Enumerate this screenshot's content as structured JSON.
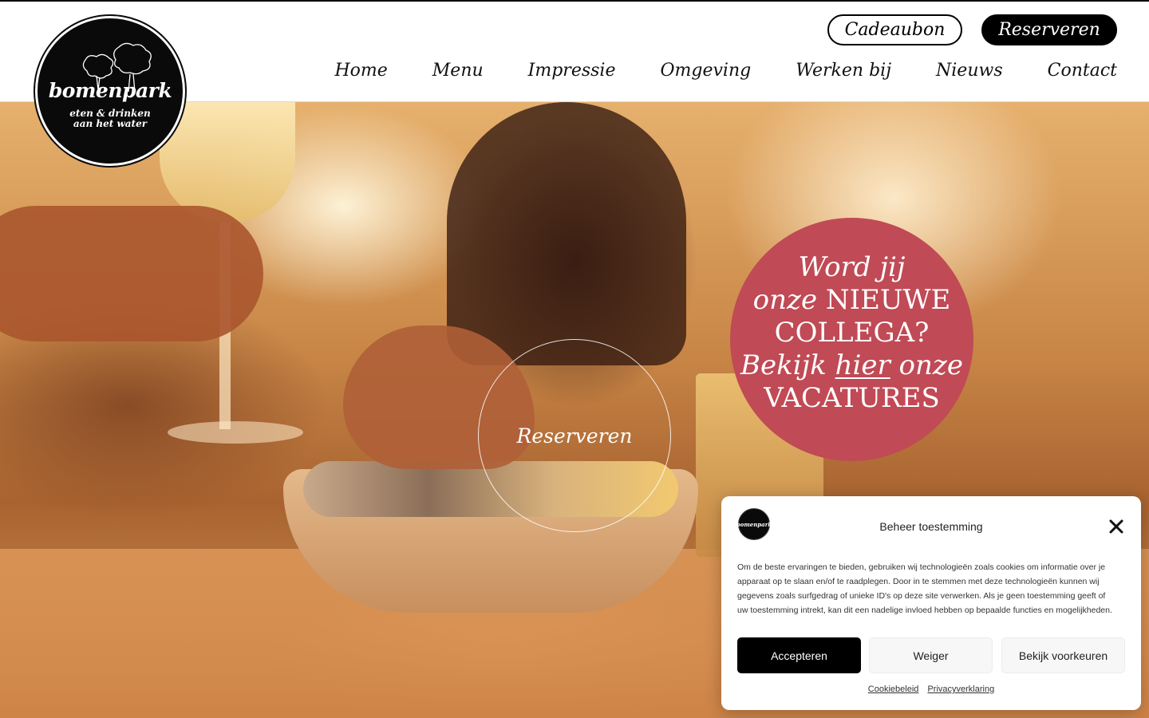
{
  "brand": {
    "name": "bomenpark",
    "tagline_1": "eten & drinken",
    "tagline_2": "aan het water"
  },
  "header": {
    "gift_label": "Cadeaubon",
    "reserve_label": "Reserveren",
    "nav": [
      "Home",
      "Menu",
      "Impressie",
      "Omgeving",
      "Werken bij",
      "Nieuws",
      "Contact"
    ]
  },
  "hero": {
    "reserve_label": "Reserveren",
    "vacancy": {
      "line1": "Word jij",
      "line2_italic": "onze",
      "line2_caps": "NIEUWE",
      "line3": "COLLEGA?",
      "line4_a": "Bekijk",
      "line4_link": "hier",
      "line4_b": "onze",
      "line5": "VACATURES"
    }
  },
  "cookie": {
    "title": "Beheer toestemming",
    "text": "Om de beste ervaringen te bieden, gebruiken wij technologieën zoals cookies om informatie over je apparaat op te slaan en/of te raadplegen. Door in te stemmen met deze technologieën kunnen wij gegevens zoals surfgedrag of unieke ID's op deze site verwerken. Als je geen toestemming geeft of uw toestemming intrekt, kan dit een nadelige invloed hebben op bepaalde functies en mogelijkheden.",
    "accept": "Accepteren",
    "deny": "Weiger",
    "preferences": "Bekijk voorkeuren",
    "link_cookie": "Cookiebeleid",
    "link_privacy": "Privacyverklaring"
  },
  "colors": {
    "accent": "#c04a55",
    "black": "#000000",
    "white": "#ffffff"
  }
}
